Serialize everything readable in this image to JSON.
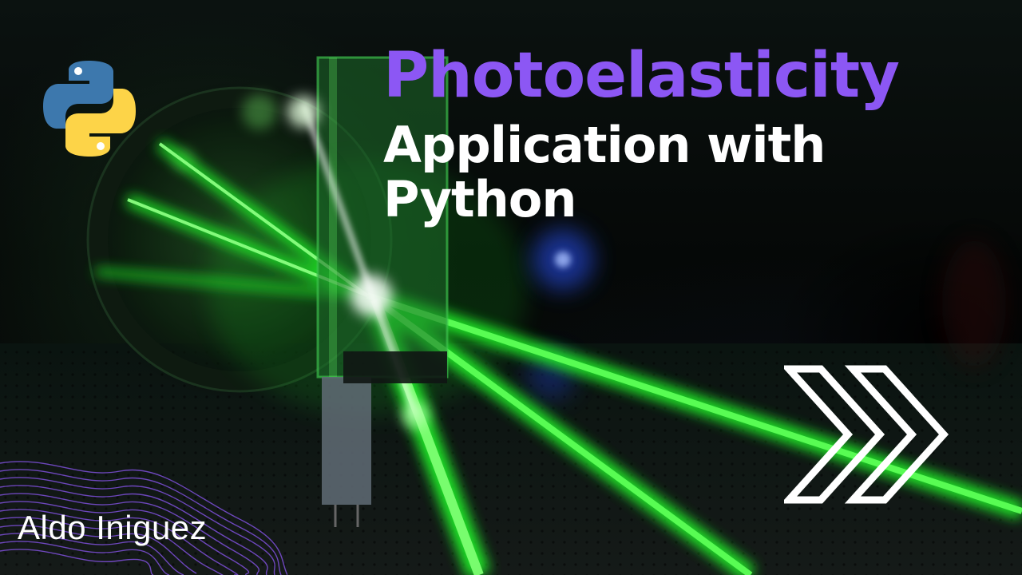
{
  "thumbnail": {
    "title": "Photoelasticity",
    "subtitle_line1": "Application with",
    "subtitle_line2": "Python",
    "author": "Aldo Iniguez",
    "colors": {
      "title": "#8c57f4",
      "subtitle": "#ffffff",
      "laser": "#39ff3a",
      "background": "#050807"
    },
    "icons": {
      "logo": "python-logo-icon",
      "arrows": "double-chevron-right-icon",
      "decoration": "wave-lines-decoration"
    }
  }
}
